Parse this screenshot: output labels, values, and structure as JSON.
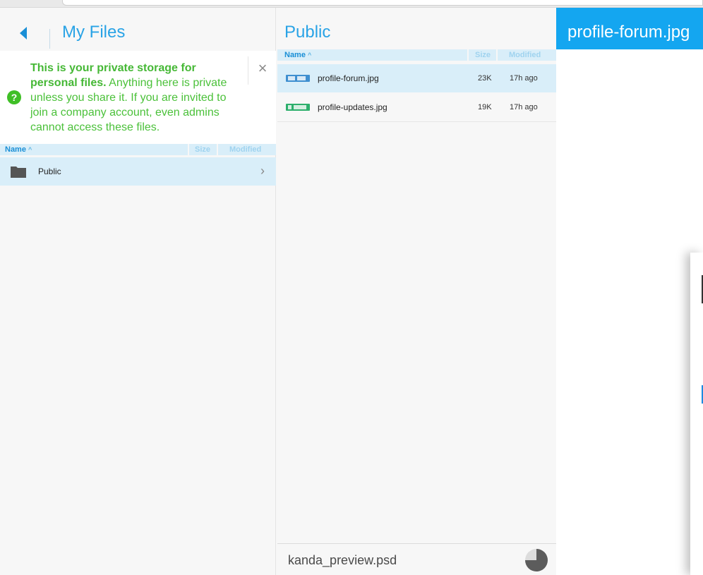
{
  "left_pane": {
    "title": "My Files",
    "notice": {
      "bold_text": "This is your private storage for personal files.",
      "body_text": " Anything here is private unless you share it. If you are invited to join a company account, even admins cannot access these files.",
      "help_glyph": "?",
      "close_glyph": "×"
    },
    "columns": {
      "name": "Name",
      "size": "Size",
      "modified": "Modified"
    },
    "items": [
      {
        "name": "Public",
        "icon": "folder-icon"
      }
    ]
  },
  "mid_pane": {
    "title": "Public",
    "columns": {
      "name": "Name",
      "size": "Size",
      "modified": "Modified"
    },
    "files": [
      {
        "name": "profile-forum.jpg",
        "size": "23K",
        "modified": "17h ago",
        "selected": true
      },
      {
        "name": "profile-updates.jpg",
        "size": "19K",
        "modified": "17h ago",
        "selected": false
      }
    ],
    "upload": {
      "filename": "kanda_preview.psd",
      "progress": 0.75
    }
  },
  "preview": {
    "title": "profile-forum.jpg"
  },
  "colors": {
    "accent": "#29a3e6",
    "header_bg": "#14a6f0",
    "selected_row": "#d9eef9",
    "notice_green": "#4bc13a"
  }
}
